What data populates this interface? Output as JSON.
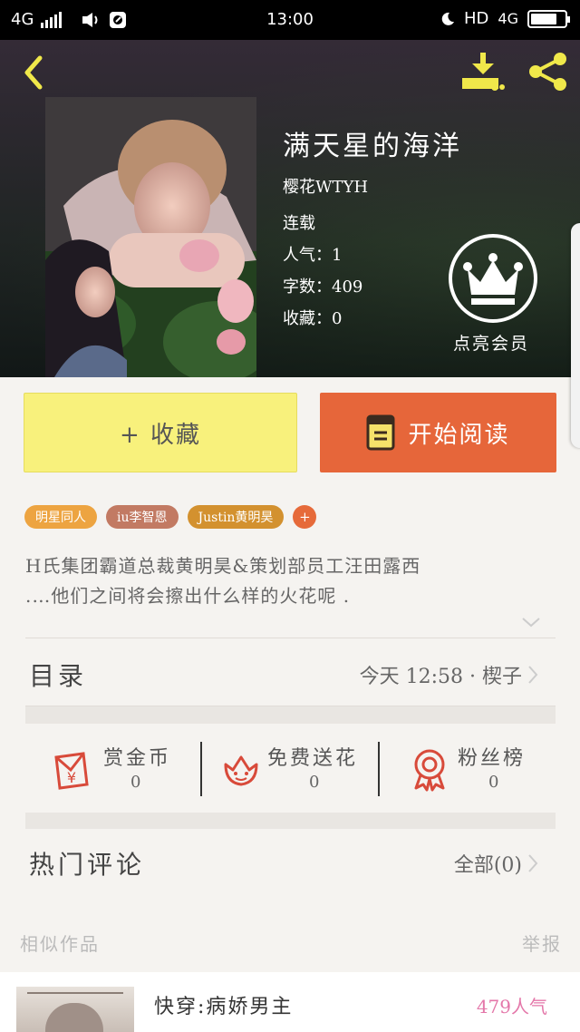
{
  "status_bar": {
    "network_left": "4G",
    "time": "13:00",
    "hd": "HD",
    "network_right": "4G",
    "battery_level": 0.8
  },
  "header": {
    "back_icon": "chevron-left-icon",
    "download_icon": "download-icon",
    "share_icon": "share-icon",
    "accent_color": "#f0e84a"
  },
  "book": {
    "title": "满天星的海洋",
    "author": "樱花WTYH",
    "status": "连载",
    "popularity_label": "人气：",
    "popularity": "1",
    "words_label": "字数：",
    "words": "409",
    "favorites_label": "收藏：",
    "favorites": "0",
    "vip_label": "点亮会员"
  },
  "actions": {
    "favorite_label": "+ 收藏",
    "read_label": "开始阅读",
    "favorite_color": "#f8f17c",
    "read_color": "#e6663a"
  },
  "tags": [
    "明星同人",
    "iu李智恩",
    "Justin黄明昊",
    "+"
  ],
  "description": {
    "line1": "H氏集团霸道总裁黄明昊&策划部员工汪田露西",
    "line2": ".…他们之间将会擦出什么样的火花呢 ."
  },
  "catalog": {
    "title": "目录",
    "latest": "今天 12:58 · 楔子"
  },
  "stats": [
    {
      "label": "赏金币",
      "value": "0",
      "icon": "reward-coin-icon"
    },
    {
      "label": "免费送花",
      "value": "0",
      "icon": "flower-icon"
    },
    {
      "label": "粉丝榜",
      "value": "0",
      "icon": "medal-icon"
    }
  ],
  "comments": {
    "title": "热门评论",
    "all_label": "全部(0)"
  },
  "similar": {
    "title": "相似作品",
    "report": "举报",
    "items": [
      {
        "title": "快穿:病娇男主",
        "popularity": "479人气"
      }
    ]
  }
}
